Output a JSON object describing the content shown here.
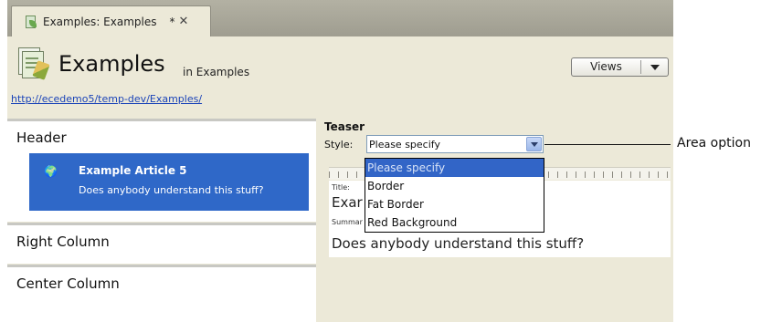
{
  "tab": {
    "label": "Examples: Examples",
    "modified": "*",
    "close": "✕"
  },
  "header": {
    "title": "Examples",
    "subtitle": "in Examples",
    "url": "http://ecedemo5/temp-dev/Examples/",
    "views_label": "Views"
  },
  "areas": {
    "header": "Header",
    "right_column": "Right Column",
    "center_column": "Center Column"
  },
  "article": {
    "title": "Example Article 5",
    "summary": "Does anybody understand this stuff?"
  },
  "teaser": {
    "label": "Teaser",
    "style_label": "Style:",
    "style_value": "Please specify",
    "options": [
      "Please specify",
      "Border",
      "Fat Border",
      "Red Background"
    ],
    "selected_index": 0,
    "preview_title_label": "Title:",
    "preview_title": "Exar",
    "preview_summary_label": "Summar",
    "preview_summary": "Does anybody understand this stuff?"
  },
  "callout": "Area option",
  "colors": {
    "selection": "#2f68c8",
    "link": "#1b44b8",
    "frame": "#ece9d8"
  }
}
